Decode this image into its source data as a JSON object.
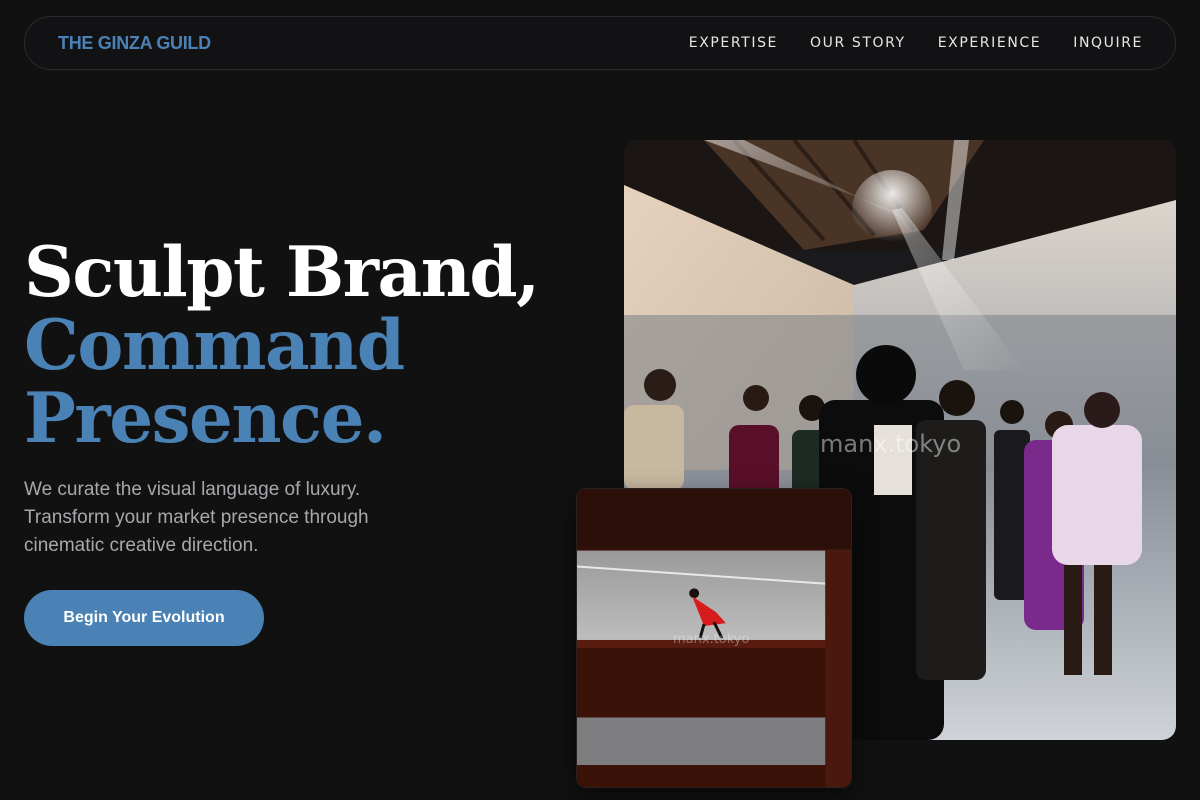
{
  "nav": {
    "brand": "THE GINZA GUILD",
    "links": [
      "EXPERTISE",
      "OUR STORY",
      "EXPERIENCE",
      "INQUIRE"
    ]
  },
  "hero": {
    "title_line1": "Sculpt Brand,",
    "title_line2": "Command",
    "title_line3": "Presence.",
    "subtitle": "We curate the visual language of luxury. Transform your market presence through cinematic creative direction.",
    "cta_label": "Begin Your Evolution"
  },
  "images": {
    "main_watermark": "manx.tokyo",
    "inset_watermark": "manx.tokyo"
  },
  "colors": {
    "background": "#111112",
    "accent": "#4a82b5",
    "text_primary": "#ffffff",
    "text_muted": "#a7a8ac",
    "nav_border": "#2a2b2e"
  }
}
